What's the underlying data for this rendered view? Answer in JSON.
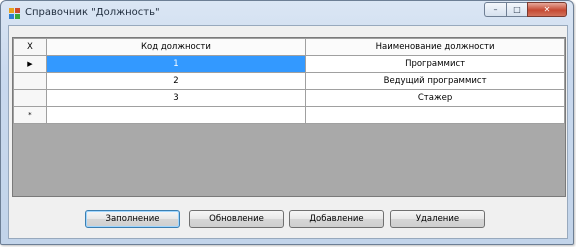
{
  "window": {
    "title": "Справочник \"Должность\"",
    "controls": {
      "minimize": "–",
      "maximize": "□",
      "close": "✕"
    }
  },
  "grid": {
    "columns": {
      "delete": "X",
      "code": "Код должности",
      "name": "Наименование должности"
    },
    "rows": [
      {
        "marker": "▶",
        "code": "1",
        "name": "Программист",
        "selected": true
      },
      {
        "marker": "",
        "code": "2",
        "name": "Ведущий программист",
        "selected": false
      },
      {
        "marker": "",
        "code": "3",
        "name": "Стажер",
        "selected": false
      }
    ],
    "new_row_marker": "*"
  },
  "buttons": {
    "fill": "Заполнение",
    "update": "Обновление",
    "add": "Добавление",
    "delete": "Удаление"
  },
  "colors": {
    "selection": "#3399ff",
    "grid_background": "#a9a9a9",
    "close_button": "#c54a33"
  }
}
